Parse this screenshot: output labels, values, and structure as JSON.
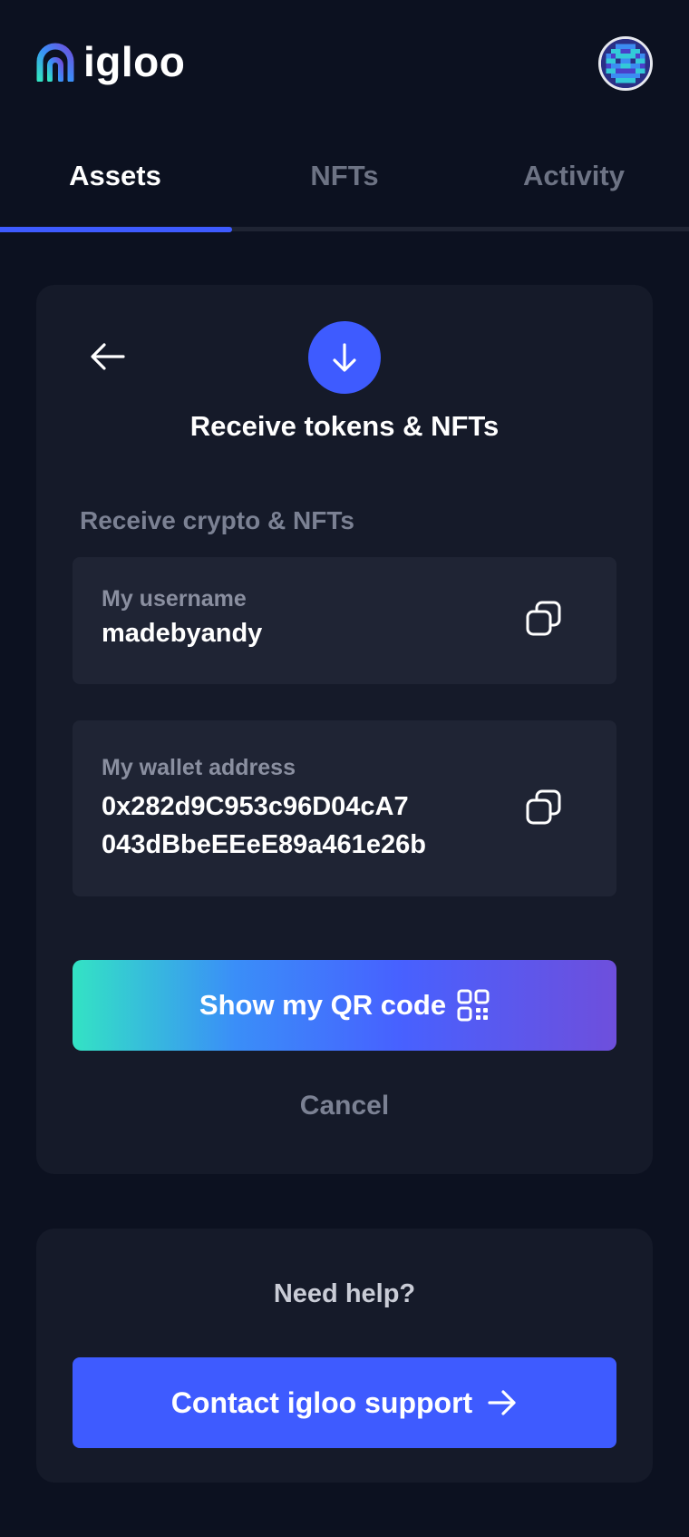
{
  "app": {
    "logo_text": "igloo"
  },
  "tabs": [
    {
      "label": "Assets",
      "active": true
    },
    {
      "label": "NFTs",
      "active": false
    },
    {
      "label": "Activity",
      "active": false
    }
  ],
  "receive": {
    "title": "Receive tokens & NFTs",
    "section_label": "Receive crypto & NFTs",
    "username": {
      "label": "My username",
      "value": "madebyandy"
    },
    "wallet": {
      "label": "My wallet address",
      "value_line1": "0x282d9C953c96D04cA7",
      "value_line2": "043dBbeEEeE89a461e26b"
    },
    "qr_button_label": "Show my QR code",
    "cancel_label": "Cancel"
  },
  "help": {
    "title": "Need help?",
    "support_label": "Contact igloo support"
  },
  "colors": {
    "background": "#0c1120",
    "card": "#151a29",
    "field": "#1f2434",
    "accent": "#3e5bff",
    "muted_text": "#7b8193",
    "gradient_start": "#33e3c4",
    "gradient_end": "#6e4fdc"
  },
  "icons": {
    "logo": "igloo-arch-logo",
    "back": "arrow-left-icon",
    "receive": "arrow-down-icon",
    "copy": "copy-icon",
    "qr": "qr-code-icon",
    "support_arrow": "arrow-right-icon"
  }
}
